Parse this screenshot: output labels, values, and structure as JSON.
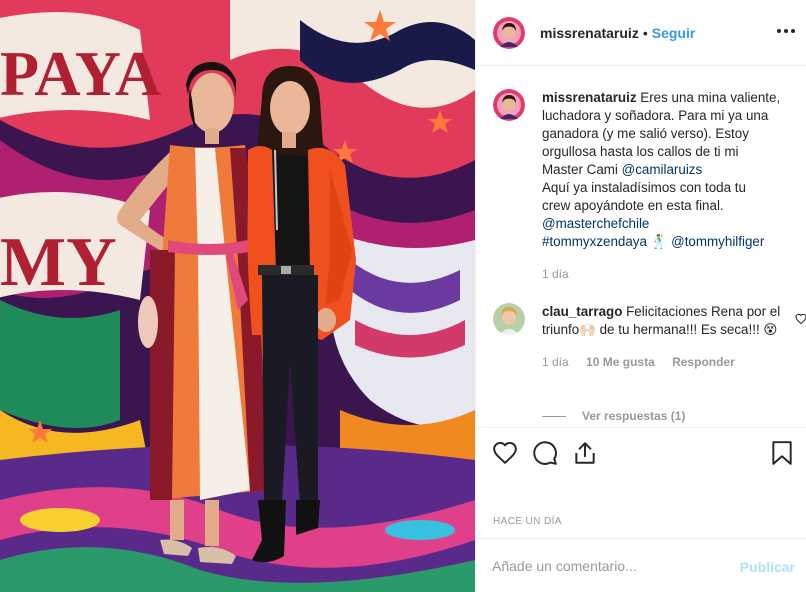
{
  "post": {
    "username": "missrenataruiz",
    "follow_label": "Seguir",
    "more_icon": "more-options-icon",
    "separator": "•"
  },
  "caption": {
    "username": "missrenataruiz",
    "line1": "Eres una mina valiente,",
    "line2": "luchadora y soñadora. Para mi ya una",
    "line3": "ganadora (y me salió verso). Estoy",
    "line4": "orgullosa hasta los callos de ti mi",
    "line5_text": "Master Cami ",
    "line5_mention": "@camilaruizs",
    "line6": "Aquí ya instaladísimos con toda tu",
    "line7": "crew apoyándote en esta final.",
    "mention_masterchef": "@masterchefchile",
    "hashtag": "#tommyxzendaya",
    "emoji": "🕺",
    "mention_tommy": "@tommyhilfiger",
    "time": "1 día"
  },
  "reply": {
    "username": "clau_tarrago",
    "line1": "Felicitaciones Rena",
    "line2": "por el triunfo🙌🏻 de tu",
    "line3": "hermana!!! Es seca!!! 😵",
    "time": "1 día",
    "likes": "10 Me gusta",
    "reply_label": "Responder",
    "view_replies": "Ver respuestas (1)"
  },
  "actions": {
    "like_icon": "heart-icon",
    "comment_icon": "comment-icon",
    "share_icon": "share-icon",
    "save_icon": "bookmark-icon"
  },
  "timestamp": "HACE UN DÍA",
  "comment_box": {
    "placeholder": "Añade un comentario...",
    "publish_label": "Publicar"
  },
  "photo": {
    "wall_text_top": "PAYA",
    "wall_text_mid": "MY"
  },
  "colors": {
    "link": "#003569",
    "follow": "#3897f0",
    "publish_disabled": "#b2dffc",
    "muted": "#999999"
  }
}
